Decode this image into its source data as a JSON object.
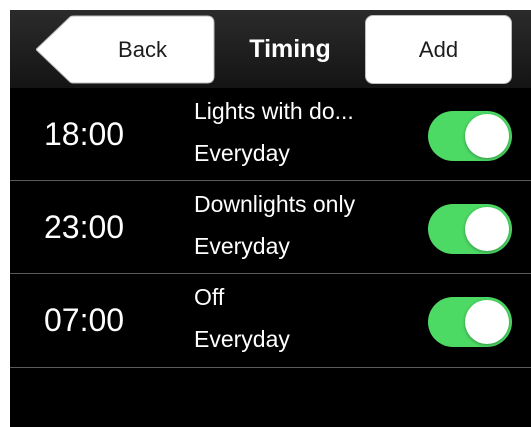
{
  "navbar": {
    "back_label": "Back",
    "title": "Timing",
    "add_label": "Add"
  },
  "timers": [
    {
      "time": "18:00",
      "name": "Lights with do...",
      "repeat": "Everyday",
      "enabled": true
    },
    {
      "time": "23:00",
      "name": "Downlights only",
      "repeat": "Everyday",
      "enabled": true
    },
    {
      "time": "07:00",
      "name": "Off",
      "repeat": "Everyday",
      "enabled": true
    }
  ],
  "colors": {
    "toggle_on": "#4cd964",
    "background": "#000000"
  }
}
